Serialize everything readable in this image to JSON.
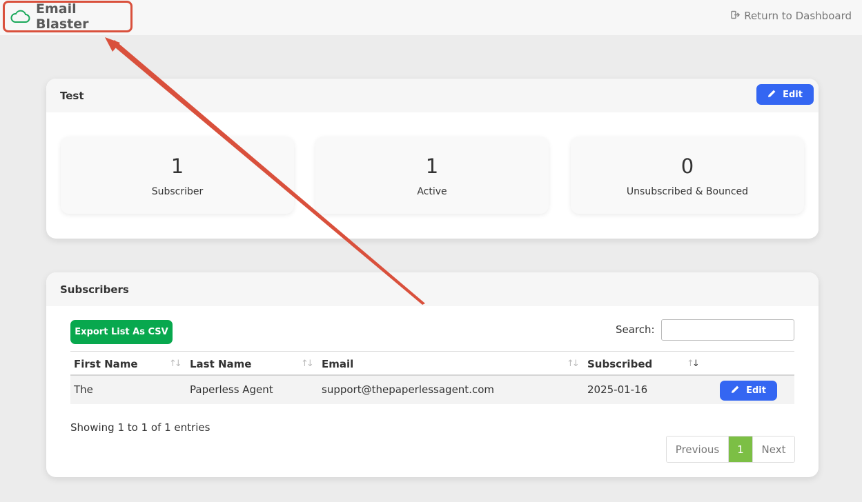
{
  "header": {
    "brand_name": "Email Blaster",
    "brand_icon": "cloud-icon",
    "return_link": "Return to Dashboard",
    "return_icon": "sign-out-icon"
  },
  "list_card": {
    "title": "Test",
    "edit_label": "Edit",
    "stats": [
      {
        "value": "1",
        "label": "Subscriber"
      },
      {
        "value": "1",
        "label": "Active"
      },
      {
        "value": "0",
        "label": "Unsubscribed & Bounced"
      }
    ]
  },
  "subscribers_card": {
    "title": "Subscribers",
    "export_label": "Export List As CSV",
    "search_label": "Search:",
    "search_value": "",
    "columns": [
      "First Name",
      "Last Name",
      "Email",
      "Subscribed"
    ],
    "rows": [
      {
        "first_name": "The",
        "last_name": "Paperless Agent",
        "email": "support@thepaperlessagent.com",
        "subscribed": "2025-01-16",
        "edit_label": "Edit"
      }
    ],
    "info": "Showing 1 to 1 of 1 entries",
    "pagination": {
      "previous": "Previous",
      "current": "1",
      "next": "Next"
    }
  },
  "colors": {
    "annotation": "#d9503c",
    "primary": "#3466f2",
    "success": "#08a84e",
    "page_active": "#7cbf45"
  }
}
